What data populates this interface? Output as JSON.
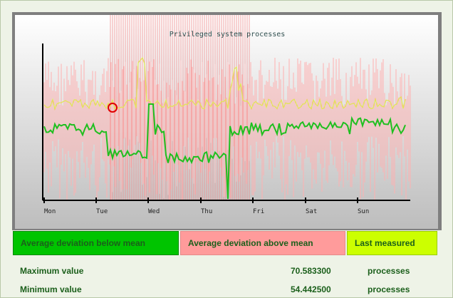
{
  "chart": {
    "title": "Privileged system processes",
    "days": [
      "Mon",
      "Tue",
      "Wed",
      "Thu",
      "Fri",
      "Sat",
      "Sun"
    ],
    "colors": {
      "below": "#00c400",
      "above": "#ff9b9b",
      "last": "#ccff00"
    }
  },
  "legend": {
    "below": "Average deviation below mean",
    "above": "Average deviation above mean",
    "last": "Last measured"
  },
  "stats": [
    {
      "label": "Maximum value",
      "value": "70.583300",
      "unit": "processes"
    },
    {
      "label": "Minimum value",
      "value": "54.442500",
      "unit": "processes"
    }
  ]
}
